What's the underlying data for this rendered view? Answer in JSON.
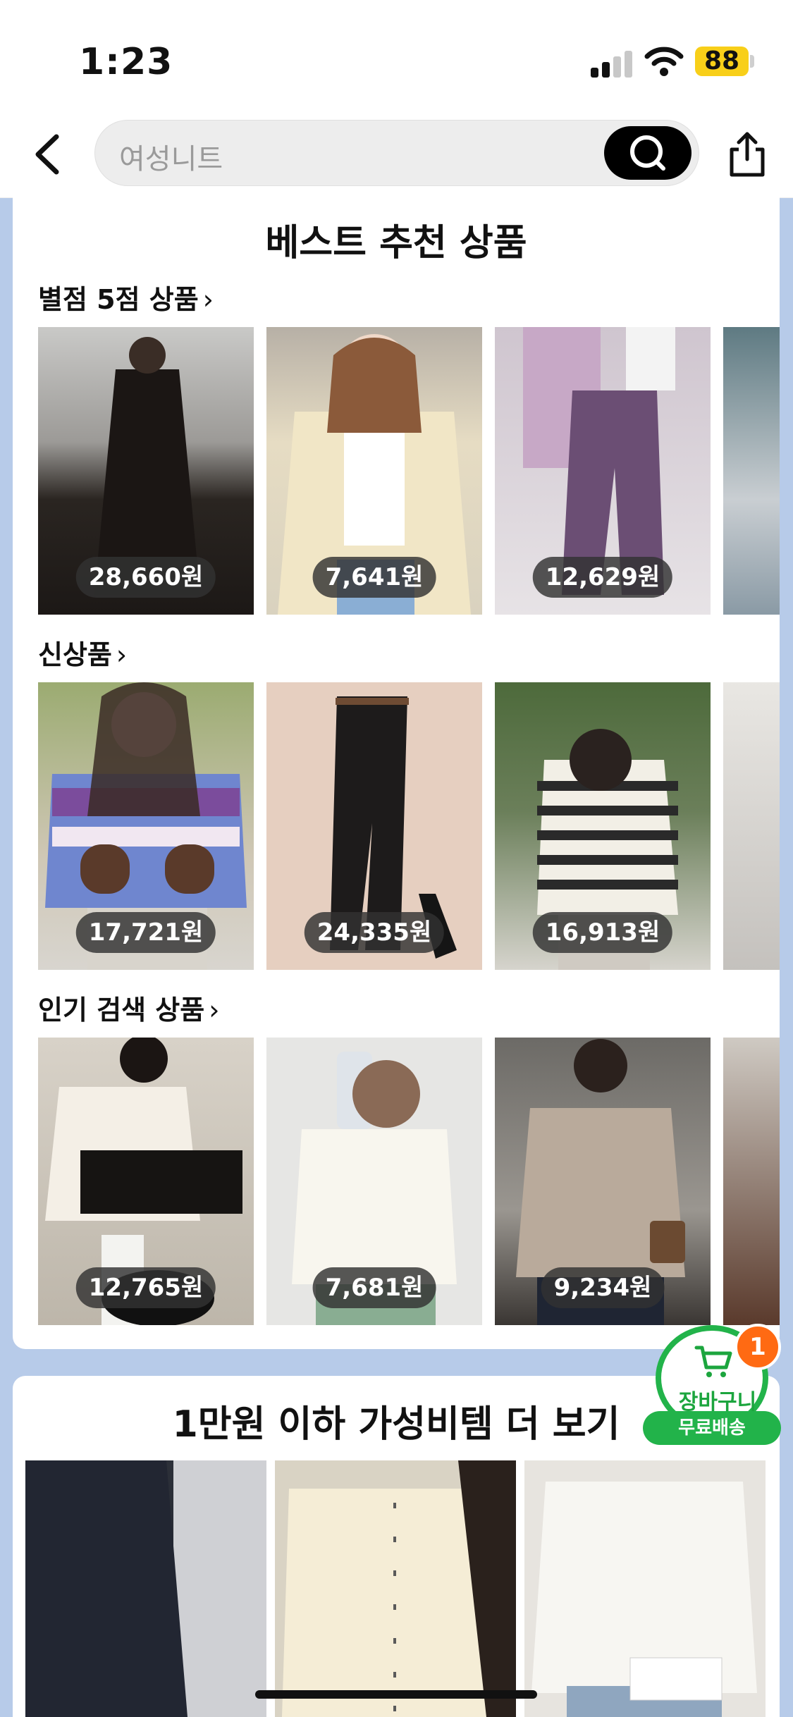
{
  "status_bar": {
    "time": "1:23",
    "battery": "88"
  },
  "header": {
    "search_placeholder": "여성니트"
  },
  "best": {
    "title": "베스트 추천 상품",
    "sections": [
      {
        "title": "별점 5점 상품",
        "items": [
          {
            "price": "28,660원",
            "image": "black long coat"
          },
          {
            "price": "7,641원",
            "image": "cream cardigan"
          },
          {
            "price": "12,629원",
            "image": "purple jogger pants"
          }
        ]
      },
      {
        "title": "신상품",
        "items": [
          {
            "price": "17,721원",
            "image": "nordic blue sweater"
          },
          {
            "price": "24,335원",
            "image": "black trousers"
          },
          {
            "price": "16,913원",
            "image": "striped hoodie"
          }
        ]
      },
      {
        "title": "인기 검색 상품",
        "items": [
          {
            "price": "12,765원",
            "image": "black white cardigan"
          },
          {
            "price": "7,681원",
            "image": "white cardigan"
          },
          {
            "price": "9,234원",
            "image": "beige turtleneck"
          }
        ]
      }
    ]
  },
  "bargain": {
    "title": "1만원 이하 가성비템 더 보기"
  },
  "cart": {
    "label": "장바구니",
    "count": "1",
    "shipping": "무료배송"
  },
  "colors": {
    "accent_green": "#22b34a",
    "badge_orange": "#ff6a13",
    "background_blue": "#b7cbe9"
  }
}
